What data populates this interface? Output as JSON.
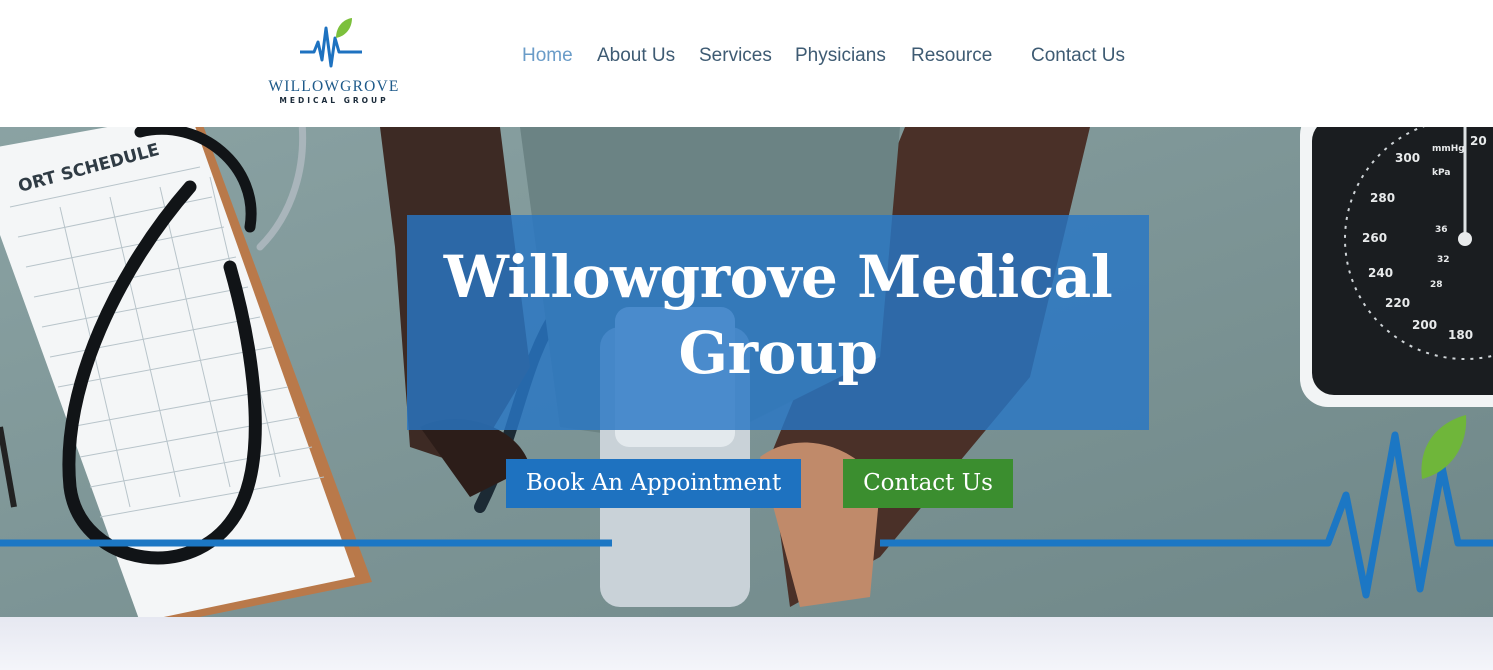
{
  "brand": {
    "name": "WILLOWGROVE",
    "tagline": "MEDICAL GROUP",
    "colors": {
      "primary": "#1e72c0",
      "leaf": "#7cc03c",
      "text": "#1e5a8a"
    }
  },
  "nav": {
    "items": [
      {
        "label": "Home",
        "active": true
      },
      {
        "label": "About Us",
        "active": false
      },
      {
        "label": "Services",
        "active": false
      },
      {
        "label": "Physicians",
        "active": false
      },
      {
        "label": "Resource",
        "active": false
      },
      {
        "label": "Contact Us",
        "active": false
      }
    ]
  },
  "hero": {
    "title": "Willowgrove Medical Group",
    "buttons": {
      "book": "Book An Appointment",
      "contact": "Contact Us"
    },
    "background_image": {
      "clipboard_heading": "ORT SCHEDULE",
      "gauge_labels": [
        "300",
        "280",
        "260",
        "240",
        "220",
        "200",
        "180",
        "36",
        "32",
        "28",
        "20",
        "kPa",
        "mmHg"
      ]
    },
    "colors": {
      "overlay": "#2876c4",
      "book_button": "#1e72c0",
      "contact_button": "#3b8e2f"
    }
  }
}
